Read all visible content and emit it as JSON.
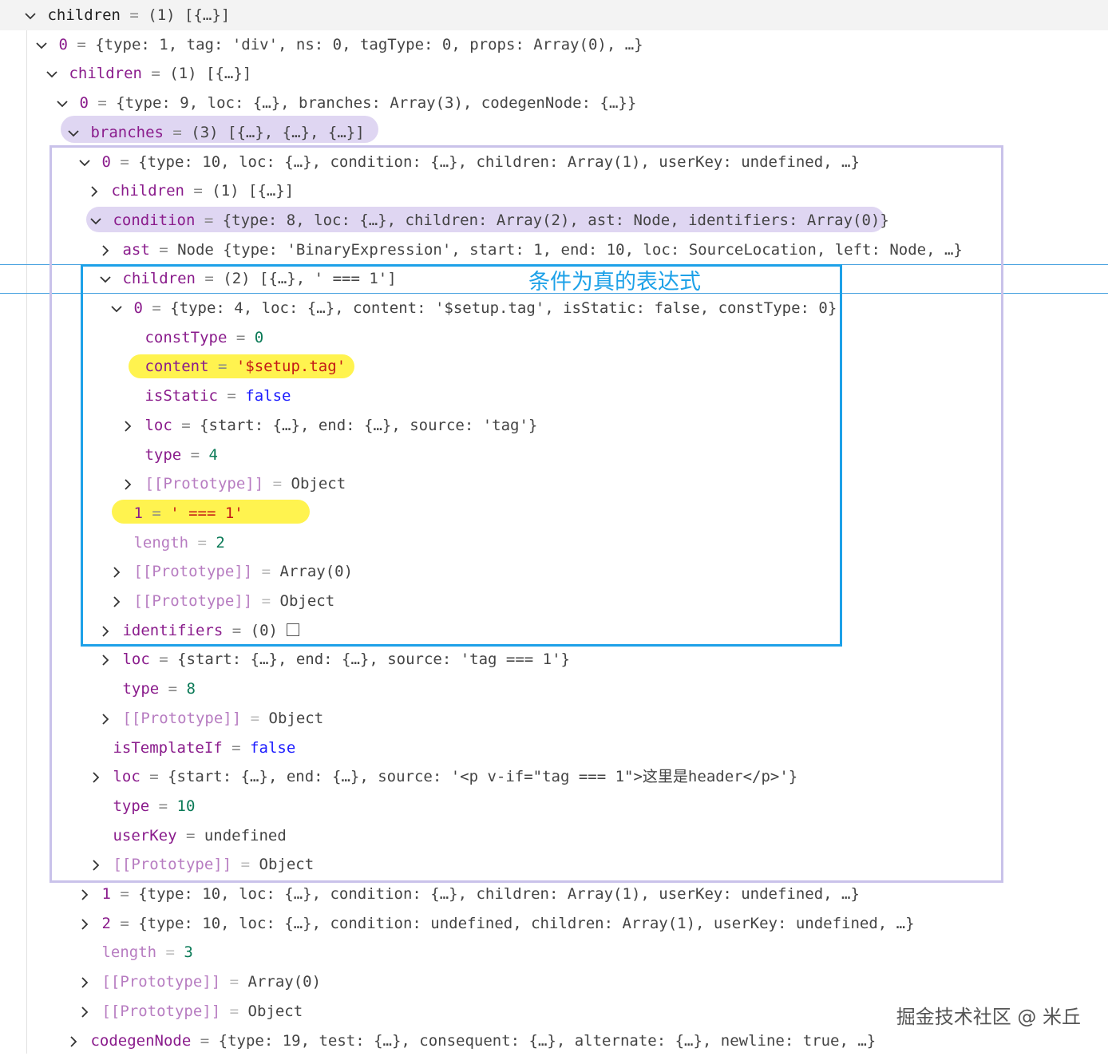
{
  "rows": [
    {
      "chev": "down",
      "key": "children",
      "value": "(1) [{…}]"
    },
    {
      "chev": "down",
      "key": "0",
      "value": "{type: 1, tag: 'div', ns: 0, tagType: 0, props: Array(0), …}"
    },
    {
      "chev": "down",
      "key": "children",
      "value": "(1) [{…}]"
    },
    {
      "chev": "down",
      "key": "0",
      "value": "{type: 9, loc: {…}, branches: Array(3), codegenNode: {…}}"
    },
    {
      "chev": "down",
      "key": "branches",
      "value": "(3) [{…}, {…}, {…}]"
    },
    {
      "chev": "down",
      "key": "0",
      "value": "{type: 10, loc: {…}, condition: {…}, children: Array(1), userKey: undefined, …}"
    },
    {
      "chev": "right",
      "key": "children",
      "value": "(1) [{…}]"
    },
    {
      "chev": "down",
      "key": "condition",
      "value": "{type: 8, loc: {…}, children: Array(2), ast: Node, identifiers: Array(0)}"
    },
    {
      "chev": "right",
      "key": "ast",
      "value": "Node {type: 'BinaryExpression', start: 1, end: 10, loc: SourceLocation, left: Node, …}"
    },
    {
      "chev": "down",
      "key": "children",
      "value": "(2) [{…}, ' === 1']"
    },
    {
      "chev": "down",
      "key": "0",
      "value": "{type: 4, loc: {…}, content: '$setup.tag', isStatic: false, constType: 0}"
    },
    {
      "chev": "none",
      "key": "constType",
      "value": "0"
    },
    {
      "chev": "none",
      "key": "content",
      "value": "'$setup.tag'"
    },
    {
      "chev": "none",
      "key": "isStatic",
      "value": "false"
    },
    {
      "chev": "right",
      "key": "loc",
      "value": "{start: {…}, end: {…}, source: 'tag'}"
    },
    {
      "chev": "none",
      "key": "type",
      "value": "4"
    },
    {
      "chev": "right",
      "key": "[[Prototype]]",
      "value": "Object"
    },
    {
      "chev": "none",
      "key": "1",
      "value": "' === 1'"
    },
    {
      "chev": "none",
      "key": "length",
      "value": "2"
    },
    {
      "chev": "right",
      "key": "[[Prototype]]",
      "value": "Array(0)"
    },
    {
      "chev": "right",
      "key": "[[Prototype]]",
      "value": "Object"
    },
    {
      "chev": "right",
      "key": "identifiers",
      "value": "(0) "
    },
    {
      "chev": "right",
      "key": "loc",
      "value": "{start: {…}, end: {…}, source: 'tag === 1'}"
    },
    {
      "chev": "none",
      "key": "type",
      "value": "8"
    },
    {
      "chev": "right",
      "key": "[[Prototype]]",
      "value": "Object"
    },
    {
      "chev": "none",
      "key": "isTemplateIf",
      "value": "false"
    },
    {
      "chev": "right",
      "key": "loc",
      "value": "{start: {…}, end: {…}, source: '<p v-if=\"tag === 1\">这里是header</p>'}"
    },
    {
      "chev": "none",
      "key": "type",
      "value": "10"
    },
    {
      "chev": "none",
      "key": "userKey",
      "value": "undefined"
    },
    {
      "chev": "right",
      "key": "[[Prototype]]",
      "value": "Object"
    },
    {
      "chev": "right",
      "key": "1",
      "value": "{type: 10, loc: {…}, condition: {…}, children: Array(1), userKey: undefined, …}"
    },
    {
      "chev": "right",
      "key": "2",
      "value": "{type: 10, loc: {…}, condition: undefined, children: Array(1), userKey: undefined, …}"
    },
    {
      "chev": "none",
      "key": "length",
      "value": "3"
    },
    {
      "chev": "right",
      "key": "[[Prototype]]",
      "value": "Array(0)"
    },
    {
      "chev": "right",
      "key": "[[Prototype]]",
      "value": "Object"
    },
    {
      "chev": "right",
      "key": "codegenNode",
      "value": "{type: 19, test: {…}, consequent: {…}, alternate: {…}, newline: true, …}"
    }
  ],
  "annotation": "条件为真的表达式",
  "watermark": "掘金技术社区 @ 米丘"
}
